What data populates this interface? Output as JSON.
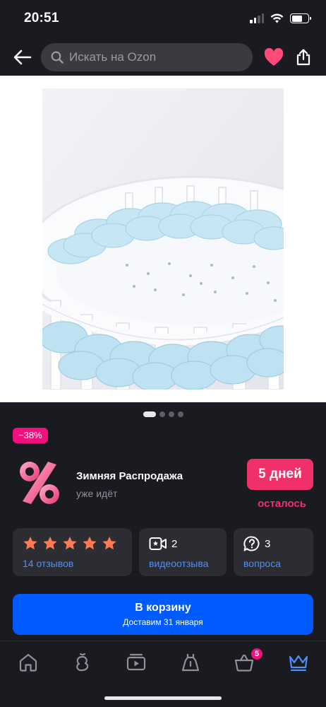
{
  "status_bar": {
    "time": "20:51"
  },
  "header": {
    "search_placeholder": "Искать на Ozon",
    "icons": [
      "back-arrow-icon",
      "search-icon",
      "heart-icon",
      "share-icon"
    ],
    "favorite_color": "#ff4a7a"
  },
  "gallery": {
    "page_count": 4,
    "active_page": 1
  },
  "product": {
    "discount": "−38%"
  },
  "promo": {
    "title": "Зимняя Распродажа",
    "subtitle": "уже идёт",
    "days": "5 дней",
    "days_suffix": "осталось"
  },
  "reviews": {
    "rating_stars": 5,
    "reviews_label": "14 отзывов",
    "video_count": "2",
    "video_label": "видеоотзыва",
    "questions_count": "3",
    "questions_label": "вопроса"
  },
  "cart": {
    "title": "В корзину",
    "delivery": "Доставим 31 января"
  },
  "tab_bar": {
    "items": [
      "home-icon",
      "fresh-icon",
      "video-icon",
      "dress-icon",
      "cart-icon",
      "premium-crown-icon"
    ],
    "cart_badge": "5",
    "active_color": "#4f8ff7"
  },
  "colors": {
    "accent_blue": "#005bff",
    "accent_pink": "#f1306a",
    "star": "#ff7a50"
  }
}
